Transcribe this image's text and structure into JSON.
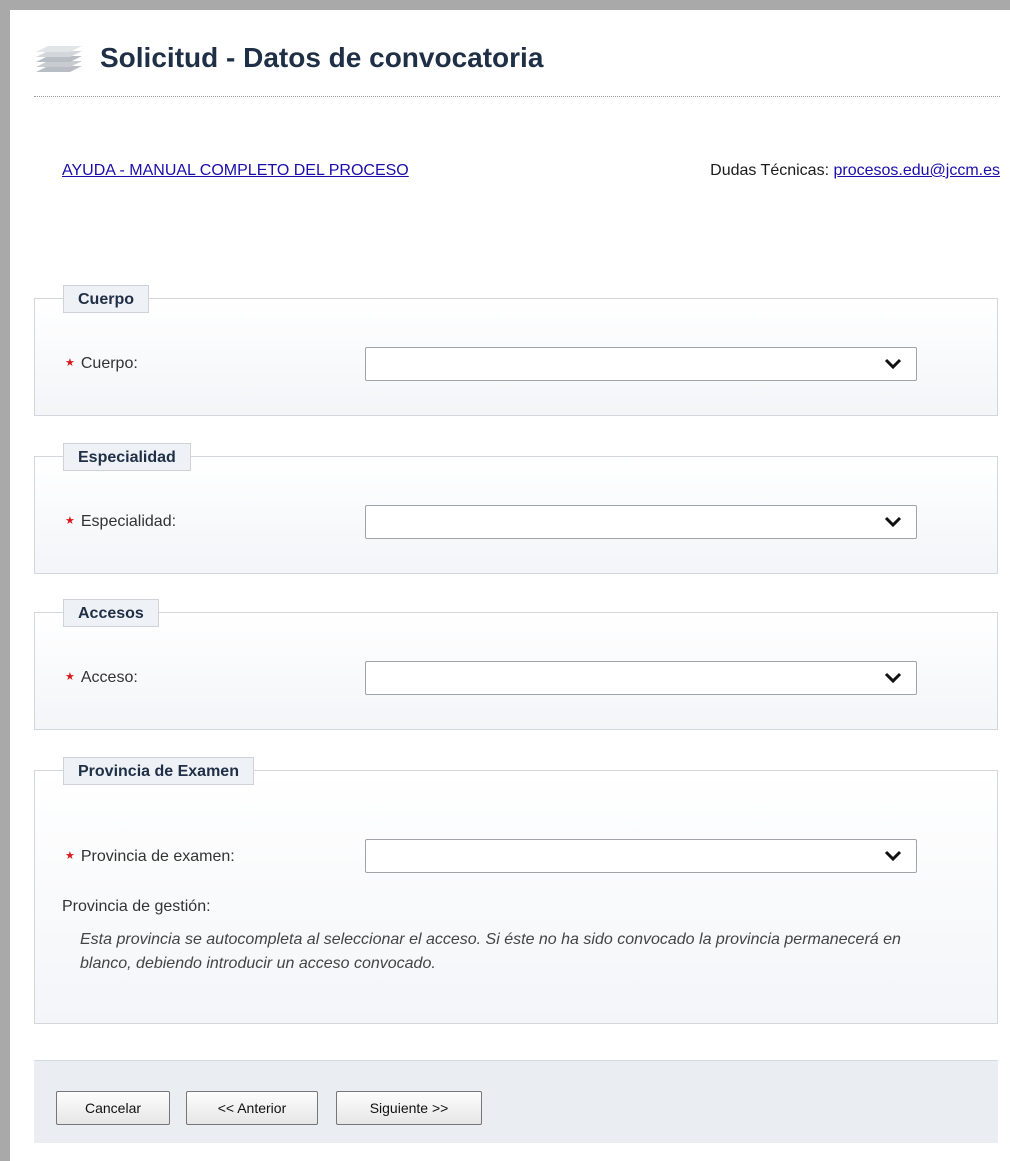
{
  "page": {
    "title": "Solicitud - Datos de convocatoria"
  },
  "links": {
    "help": "AYUDA - MANUAL COMPLETO DEL PROCESO",
    "contact_label": "Dudas Técnicas:",
    "contact_email": "procesos.edu@jccm.es"
  },
  "sections": {
    "cuerpo": {
      "legend": "Cuerpo",
      "field_label": "Cuerpo:",
      "value": ""
    },
    "especialidad": {
      "legend": "Especialidad",
      "field_label": "Especialidad:",
      "value": ""
    },
    "accesos": {
      "legend": "Accesos",
      "field_label": "Acceso:",
      "value": ""
    },
    "provincia": {
      "legend": "Provincia de Examen",
      "field_label": "Provincia de examen:",
      "value": "",
      "gestion_label": "Provincia de gestión:",
      "note": "Esta provincia se autocompleta al seleccionar el acceso. Si éste no ha sido convocado la provincia permanecerá en blanco, debiendo introducir un acceso convocado."
    }
  },
  "buttons": {
    "cancel": "Cancelar",
    "previous": "<< Anterior",
    "next": "Siguiente >>"
  },
  "icons": {
    "title_icon": "stack-icon",
    "required_marker": "required-star-icon",
    "dropdown": "chevron-down-icon"
  },
  "colors": {
    "link": "#1a0dab",
    "required": "#d7191c",
    "title": "#1f2f46"
  }
}
